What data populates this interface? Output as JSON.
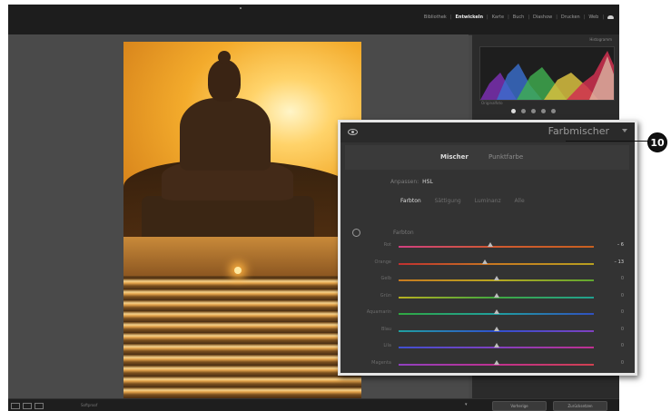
{
  "topbar": {
    "modules": [
      {
        "label": "Bibliothek",
        "active": false
      },
      {
        "label": "Entwickeln",
        "active": true
      },
      {
        "label": "Karte",
        "active": false
      },
      {
        "label": "Buch",
        "active": false
      },
      {
        "label": "Diashow",
        "active": false
      },
      {
        "label": "Drucken",
        "active": false
      },
      {
        "label": "Web",
        "active": false
      }
    ]
  },
  "right_panel": {
    "histogram_title": "Histogramm",
    "hist_info": "Originalfoto"
  },
  "bottombar": {
    "softproof": "Softproof",
    "previous_label": "Vorherige",
    "reset_label": "Zurücksetzen"
  },
  "hsl_panel": {
    "title": "Farbmischer",
    "tabs": {
      "mixer": "Mischer",
      "point_color": "Punktfarbe"
    },
    "adjust_label": "Anpassen:",
    "adjust_value": "HSL",
    "modes": {
      "hue": "Farbton",
      "saturation": "Sättigung",
      "luminance": "Luminanz",
      "all": "Alle"
    },
    "section_label": "Farbton",
    "sliders": [
      {
        "label": "Rot",
        "value": "– 6",
        "fraction": 0.47,
        "gradient": "#d04080,#d05a30,#c86020"
      },
      {
        "label": "Orange",
        "value": "– 13",
        "fraction": 0.44,
        "gradient": "#c03030,#c87a20,#b8a020"
      },
      {
        "label": "Gelb",
        "value": "0",
        "fraction": 0.5,
        "gradient": "#c87a20,#b8a820,#60a830"
      },
      {
        "label": "Grün",
        "value": "0",
        "fraction": 0.5,
        "gradient": "#b8b020,#40a840,#20a090"
      },
      {
        "label": "Aquamarin",
        "value": "0",
        "fraction": 0.5,
        "gradient": "#30a840,#20a0a0,#3050c0"
      },
      {
        "label": "Blau",
        "value": "0",
        "fraction": 0.5,
        "gradient": "#20a0a0,#3050d0,#8040c0"
      },
      {
        "label": "Lila",
        "value": "0",
        "fraction": 0.5,
        "gradient": "#4050d0,#8040c0,#c03090"
      },
      {
        "label": "Magenta",
        "value": "0",
        "fraction": 0.5,
        "gradient": "#9040c0,#c03090,#d04050"
      }
    ]
  },
  "callout": {
    "number": "10"
  }
}
